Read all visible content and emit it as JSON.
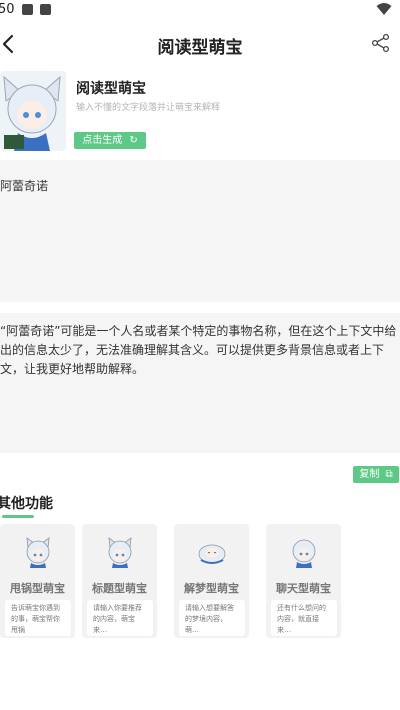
{
  "status": {
    "time": "50"
  },
  "appbar": {
    "title": "阅读型萌宝"
  },
  "header": {
    "name": "阅读型萌宝",
    "description": "输入不懂的文字段落并让萌宝来解释",
    "generate_label": "点击生成"
  },
  "input": {
    "value": "阿蕾奇诺"
  },
  "output": {
    "text": "“阿蕾奇诺”可能是一个人名或者某个特定的事物名称，但在这个上下文中给出的信息太少了，无法准确理解其含义。可以提供更多背景信息或者上下文，让我更好地帮助解释。"
  },
  "copy": {
    "label": "复制"
  },
  "other": {
    "title": "其他功能",
    "cards": [
      {
        "name": "甩锅型萌宝",
        "desc": "告诉萌宝你遇到的事，萌宝帮你甩锅"
      },
      {
        "name": "标题型萌宝",
        "desc": "请输入你要推荐的内容，萌宝来…"
      },
      {
        "name": "解梦型萌宝",
        "desc": "请输入想要解答的梦境内容，萌…"
      },
      {
        "name": "聊天型萌宝",
        "desc": "还有什么想问的内容，就直接来…"
      }
    ]
  },
  "colors": {
    "accent": "#5ec886",
    "panel": "#f5f5f5"
  }
}
